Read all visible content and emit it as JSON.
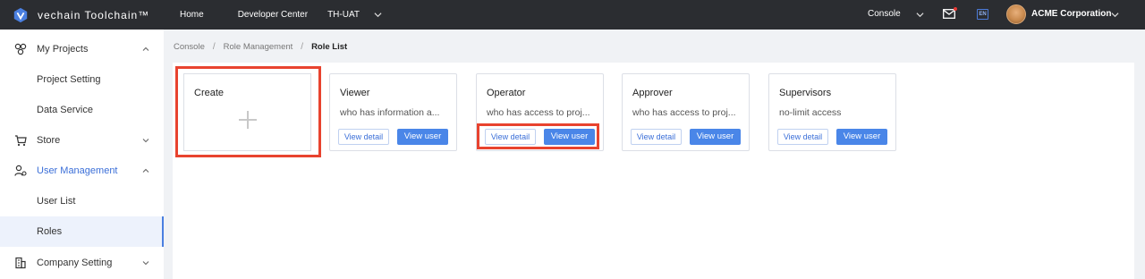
{
  "topbar": {
    "logo_text": "vechain Toolchain™",
    "nav": {
      "home": "Home",
      "developer_center": "Developer Center",
      "environment": "TH-UAT"
    },
    "console": "Console",
    "language": "EN",
    "organization": "ACME Corporation"
  },
  "sidebar": {
    "items": [
      {
        "label": "My Projects"
      },
      {
        "label": "Project Setting"
      },
      {
        "label": "Data Service"
      },
      {
        "label": "Store"
      },
      {
        "label": "User Management"
      },
      {
        "label": "User List"
      },
      {
        "label": "Roles"
      },
      {
        "label": "Company Setting"
      }
    ]
  },
  "breadcrumb": {
    "console": "Console",
    "sep1": "/",
    "role_management": "Role Management",
    "sep2": "/",
    "current": "Role List"
  },
  "create_card": {
    "title": "Create",
    "icon": "plus-icon"
  },
  "roles": [
    {
      "title": "Viewer",
      "description": "who has information a...",
      "detail_label": "View detail",
      "user_label": "View user"
    },
    {
      "title": "Operator",
      "description": "who has access to proj...",
      "detail_label": "View detail",
      "user_label": "View user"
    },
    {
      "title": "Approver",
      "description": "who has access to proj...",
      "detail_label": "View detail",
      "user_label": "View user"
    },
    {
      "title": "Supervisors",
      "description": "no-limit access",
      "detail_label": "View detail",
      "user_label": "View user"
    }
  ],
  "colors": {
    "topbar": "#2b2d31",
    "accent": "#4a86e8",
    "highlight": "#e8432f",
    "active_text": "#3b6fd8"
  }
}
